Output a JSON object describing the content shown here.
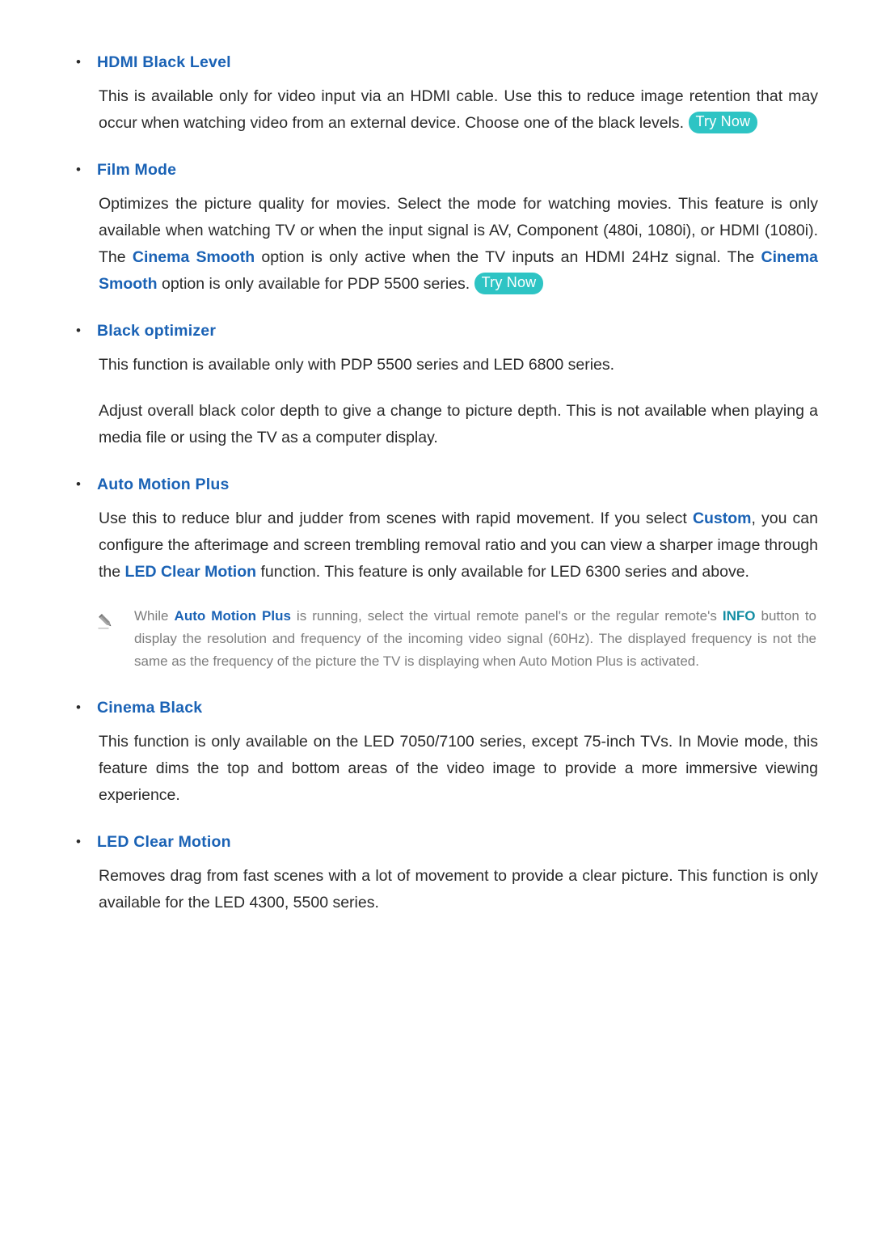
{
  "document": {
    "type": "e-manual-page",
    "colors": {
      "heading_blue": "#1a62b5",
      "link_blue": "#1a62b5",
      "link_teal": "#128da3",
      "trynow_badge": "#2ec4c4",
      "body_text": "#2a2a2a",
      "note_text": "#7d7d7d",
      "background": "#ffffff"
    },
    "badge_label": "Try Now",
    "note_icon": "pencil-icon",
    "bullet_glyph": "•"
  },
  "sections": [
    {
      "id": "hdmi-black-level",
      "heading": "HDMI Black Level",
      "paragraphs": [
        {
          "parts": [
            {
              "type": "text",
              "text": "This is available only for video input via an HDMI cable. Use this to reduce image retention that may occur when watching video from an external device. Choose one of the black levels."
            },
            {
              "type": "badge",
              "text": "Try Now"
            }
          ]
        }
      ]
    },
    {
      "id": "film-mode",
      "heading": "Film Mode",
      "paragraphs": [
        {
          "parts": [
            {
              "type": "text",
              "text": "Optimizes the picture quality for movies. Select the mode for watching movies. This feature is only available when watching TV or when the input signal is AV, Component (480i, 1080i), or HDMI (1080i). The "
            },
            {
              "type": "link",
              "text": "Cinema Smooth"
            },
            {
              "type": "text",
              "text": " option is only active when the TV inputs an HDMI 24Hz signal. The "
            },
            {
              "type": "link",
              "text": "Cinema Smooth"
            },
            {
              "type": "text",
              "text": " option is only available for PDP 5500 series."
            },
            {
              "type": "badge",
              "text": "Try Now"
            }
          ]
        }
      ]
    },
    {
      "id": "black-optimizer",
      "heading": "Black optimizer",
      "paragraphs": [
        {
          "parts": [
            {
              "type": "text",
              "text": "This function is available only with PDP 5500 series and LED 6800 series."
            }
          ]
        },
        {
          "parts": [
            {
              "type": "text",
              "text": "Adjust overall black color depth to give a change to picture depth. This is not available when playing a media file or using the TV as a computer display."
            }
          ]
        }
      ]
    },
    {
      "id": "auto-motion-plus",
      "heading": "Auto Motion Plus",
      "paragraphs": [
        {
          "parts": [
            {
              "type": "text",
              "text": "Use this to reduce blur and judder from scenes with rapid movement. If you select "
            },
            {
              "type": "link",
              "text": "Custom"
            },
            {
              "type": "text",
              "text": ", you can configure the afterimage and screen trembling removal ratio and you can view a sharper image through the "
            },
            {
              "type": "link",
              "text": "LED Clear Motion"
            },
            {
              "type": "text",
              "text": " function. This feature is only available for LED 6300 series and above."
            }
          ]
        }
      ],
      "note": {
        "icon": "pencil-icon",
        "parts": [
          {
            "type": "text",
            "text": "While "
          },
          {
            "type": "link",
            "text": "Auto Motion Plus"
          },
          {
            "type": "text",
            "text": " is running, select the virtual remote panel's or the regular remote's "
          },
          {
            "type": "link-teal",
            "text": "INFO"
          },
          {
            "type": "text",
            "text": " button to display the resolution and frequency of the incoming video signal (60Hz). The displayed frequency is not the same as the frequency of the picture the TV is displaying when Auto Motion Plus is activated."
          }
        ]
      }
    },
    {
      "id": "cinema-black",
      "heading": "Cinema Black",
      "paragraphs": [
        {
          "parts": [
            {
              "type": "text",
              "text": "This function is only available on the LED 7050/7100 series, except 75-inch TVs. In Movie mode, this feature dims the top and bottom areas of the video image to provide a more immersive viewing experience."
            }
          ]
        }
      ]
    },
    {
      "id": "led-clear-motion",
      "heading": "LED Clear Motion",
      "paragraphs": [
        {
          "parts": [
            {
              "type": "text",
              "text": "Removes drag from fast scenes with a lot of movement to provide a clear picture. This function is only available for the LED 4300, 5500 series."
            }
          ]
        }
      ]
    }
  ]
}
